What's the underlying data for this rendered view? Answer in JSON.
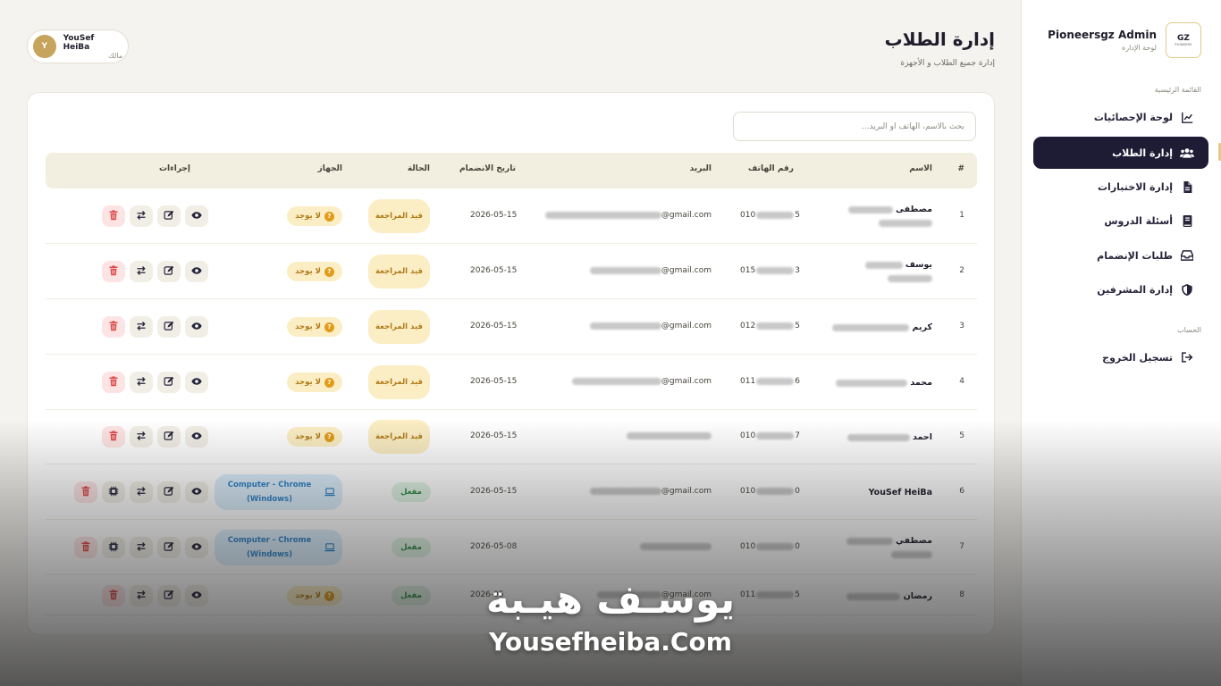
{
  "sidebar": {
    "brand_name": "Pioneersgz Admin",
    "brand_sub": "لوحة الإدارة",
    "logo_text": "GZ",
    "logo_sub": "PIONEERS",
    "section_main": "القائمة الرئيسية",
    "section_account": "الحساب",
    "items": [
      {
        "label": "لوحة الإحصائيات",
        "icon": "chart-line-icon"
      },
      {
        "label": "إدارة الطلاب",
        "icon": "users-icon",
        "active": true
      },
      {
        "label": "إدارة الاختبارات",
        "icon": "file-icon"
      },
      {
        "label": "أسئلة الدروس",
        "icon": "book-icon"
      },
      {
        "label": "طلبات الإنضمام",
        "icon": "inbox-icon"
      },
      {
        "label": "إدارة المشرفين",
        "icon": "shield-icon"
      }
    ],
    "logout_label": "تسجيل الخروج"
  },
  "header": {
    "title": "إدارة الطلاب",
    "subtitle": "إدارة جميع الطلاب و الأجهزة"
  },
  "user": {
    "initial": "Y",
    "name": "YouSef HeiBa",
    "role": "مالك"
  },
  "search": {
    "placeholder": "بحث بالاسم، الهاتف أو البريد..."
  },
  "table": {
    "columns": [
      "#",
      "الاسم",
      "رقم الهاتف",
      "البريد",
      "تاريخ الانضمام",
      "الحالة",
      "الجهاز",
      "إجراءات"
    ],
    "rows": [
      {
        "index": "1",
        "name": "مصطفى",
        "phone_start": "010",
        "phone_end": "5",
        "email_domain": "@gmail.com",
        "joined": "2026-05-15",
        "status": "قيد المراجعة",
        "status_type": "pending",
        "device": "لا يوجد",
        "device_type": "none"
      },
      {
        "index": "2",
        "name": "يوسف",
        "phone_start": "015",
        "phone_end": "3",
        "email_domain": "@gmail.com",
        "joined": "2026-05-15",
        "status": "قيد المراجعة",
        "status_type": "pending",
        "device": "لا يوجد",
        "device_type": "none"
      },
      {
        "index": "3",
        "name": "كريم",
        "phone_start": "012",
        "phone_end": "5",
        "email_domain": "@gmail.com",
        "joined": "2026-05-15",
        "status": "قيد المراجعة",
        "status_type": "pending",
        "device": "لا يوجد",
        "device_type": "none"
      },
      {
        "index": "4",
        "name": "محمد",
        "phone_start": "011",
        "phone_end": "6",
        "email_domain": "@gmail.com",
        "joined": "2026-05-15",
        "status": "قيد المراجعة",
        "status_type": "pending",
        "device": "لا يوجد",
        "device_type": "none"
      },
      {
        "index": "5",
        "name": "احمد",
        "phone_start": "010",
        "phone_end": "7",
        "email_domain": "",
        "joined": "2026-05-15",
        "status": "قيد المراجعة",
        "status_type": "pending",
        "device": "لا يوجد",
        "device_type": "none"
      },
      {
        "index": "6",
        "name": "YouSef HeiBa",
        "phone_start": "010",
        "phone_end": "0",
        "email_domain": "@gmail.com",
        "joined": "2026-05-15",
        "status": "مفعل",
        "status_type": "active",
        "device": "Computer - Chrome (Windows)",
        "device_type": "pc"
      },
      {
        "index": "7",
        "name": "مصطفي",
        "phone_start": "010",
        "phone_end": "0",
        "email_domain": "",
        "joined": "2026-05-08",
        "status": "مفعل",
        "status_type": "active",
        "device": "Computer - Chrome (Windows)",
        "device_type": "pc"
      },
      {
        "index": "8",
        "name": "رمضان",
        "phone_start": "011",
        "phone_end": "5",
        "email_domain": "@gmail.com",
        "joined": "2026-05",
        "status": "مفعل",
        "status_type": "active",
        "device": "لا يوجد",
        "device_type": "none"
      }
    ]
  },
  "watermark": {
    "arabic": "يوسـف هيـبة",
    "english": "Yousefheiba.Com"
  },
  "colors": {
    "accent_dark": "#1e1b35",
    "gold": "#e3c98a",
    "pending_bg": "#fbeec4",
    "pending_text": "#b07a18",
    "active_bg": "#dff3e3",
    "active_text": "#2d8a45",
    "device_bg": "#dbeefc",
    "device_text": "#2e83c7",
    "delete_bg": "#fde4e4",
    "delete_icon": "#e04848"
  }
}
